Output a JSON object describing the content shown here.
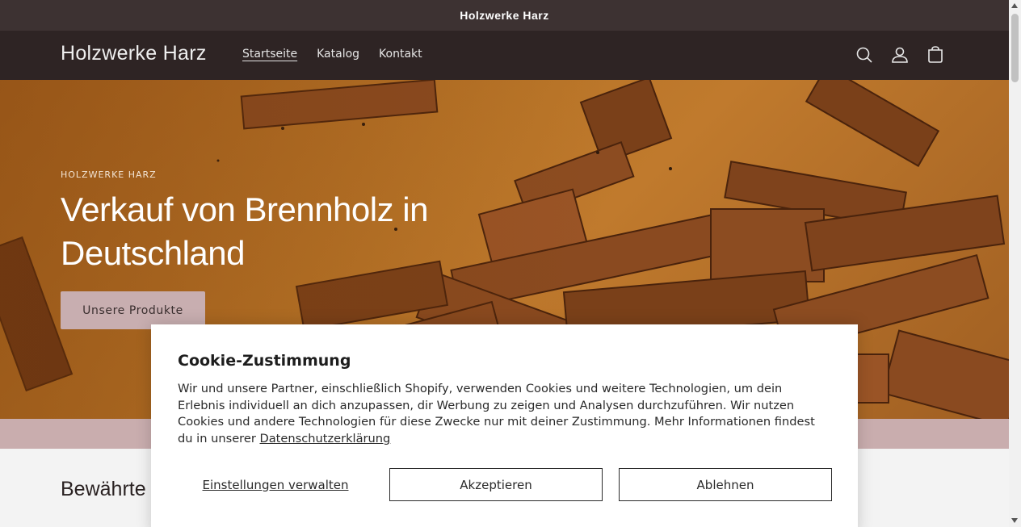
{
  "announcement": {
    "text": "Holzwerke Harz"
  },
  "header": {
    "logo": "Holzwerke Harz",
    "nav": [
      {
        "label": "Startseite",
        "active": true
      },
      {
        "label": "Katalog",
        "active": false
      },
      {
        "label": "Kontakt",
        "active": false
      }
    ],
    "icons": [
      "search-icon",
      "account-icon",
      "cart-icon"
    ]
  },
  "hero": {
    "subheading": "HOLZWERKE HARZ",
    "title": "Verkauf von Brennholz in Deutschland",
    "button_label": "Unsere Produkte"
  },
  "section": {
    "title": "Bewährte"
  },
  "cookie": {
    "title": "Cookie-Zustimmung",
    "text": "Wir und unsere Partner, einschließlich Shopify, verwenden Cookies und weitere Technologien, um dein Erlebnis individuell an dich anzupassen, dir Werbung zu zeigen und Analysen durchzuführen. Wir nutzen Cookies und andere Technologien für diese Zwecke nur mit deiner Zustimmung. Mehr Informationen findest du in unserer",
    "policy_link": "Datenschutzerklärung",
    "manage_label": "Einstellungen verwalten",
    "accept_label": "Akzeptieren",
    "decline_label": "Ablehnen"
  },
  "colors": {
    "announcement_bg": "#3d3232",
    "header_bg": "#2e2424",
    "button_bg": "#c8aeb0",
    "band": "#c9adae"
  }
}
